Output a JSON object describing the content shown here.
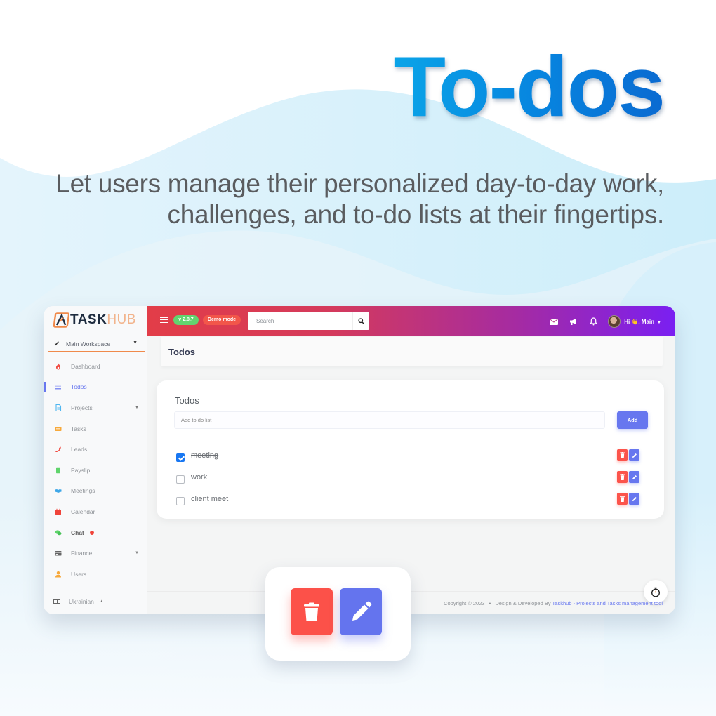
{
  "hero": {
    "title": "To-dos",
    "subtitle_line1": "Let users manage their personalized day-to-day work,",
    "subtitle_line2": "challenges, and to-do lists at their fingertips."
  },
  "brand": {
    "logo_bold": "TASK",
    "logo_light": "HUB",
    "colors": {
      "primary": "#6777ef",
      "danger": "#fc544b",
      "success": "#63d36f",
      "accent_orange": "#f08a4b",
      "topbar_start": "#e23d48",
      "topbar_end": "#7a1ff2"
    }
  },
  "sidebar": {
    "workspace": "Main Workspace",
    "items": [
      {
        "label": "Dashboard",
        "icon": "fire-icon"
      },
      {
        "label": "Todos",
        "icon": "list-icon",
        "active": true
      },
      {
        "label": "Projects",
        "icon": "file-icon",
        "has_submenu": true
      },
      {
        "label": "Tasks",
        "icon": "tasks-icon"
      },
      {
        "label": "Leads",
        "icon": "phone-icon"
      },
      {
        "label": "Payslip",
        "icon": "payslip-icon"
      },
      {
        "label": "Meetings",
        "icon": "handshake-icon"
      },
      {
        "label": "Calendar",
        "icon": "calendar-icon"
      },
      {
        "label": "Chat",
        "icon": "chat-icon",
        "has_badge": true
      },
      {
        "label": "Finance",
        "icon": "card-icon",
        "has_submenu": true
      },
      {
        "label": "Users",
        "icon": "user-icon"
      }
    ],
    "language": "Ukrainian"
  },
  "topbar": {
    "version": "v 2.8.7",
    "demo_mode": "Demo mode",
    "search_placeholder": "Search",
    "greeting": "Hi 👋, Main"
  },
  "page": {
    "title": "Todos"
  },
  "todos": {
    "card_title": "Todos",
    "input_placeholder": "Add to do list",
    "add_label": "Add",
    "items": [
      {
        "label": "meeting",
        "done": true
      },
      {
        "label": "work",
        "done": false
      },
      {
        "label": "client meet",
        "done": false
      }
    ]
  },
  "footer": {
    "copyright": "Copyright © 2023",
    "separator": "•",
    "designed_by": "Design & Developed By",
    "link": "Taskhub - Projects and Tasks management tool"
  }
}
